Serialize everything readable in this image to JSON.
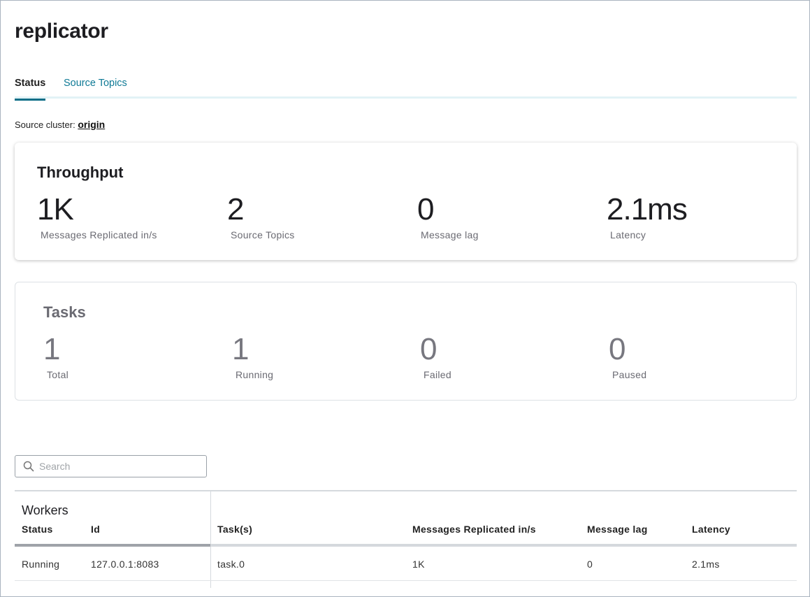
{
  "page": {
    "title": "replicator"
  },
  "tabs": [
    {
      "label": "Status",
      "active": true
    },
    {
      "label": "Source Topics",
      "active": false
    }
  ],
  "source_cluster": {
    "label": "Source cluster:",
    "value": "origin"
  },
  "throughput": {
    "title": "Throughput",
    "stats": [
      {
        "value": "1K",
        "label": "Messages Replicated in/s"
      },
      {
        "value": "2",
        "label": "Source Topics"
      },
      {
        "value": "0",
        "label": "Message lag"
      },
      {
        "value": "2.1ms",
        "label": "Latency"
      }
    ]
  },
  "tasks": {
    "title": "Tasks",
    "stats": [
      {
        "value": "1",
        "label": "Total"
      },
      {
        "value": "1",
        "label": "Running"
      },
      {
        "value": "0",
        "label": "Failed"
      },
      {
        "value": "0",
        "label": "Paused"
      }
    ]
  },
  "search": {
    "placeholder": "Search",
    "value": ""
  },
  "workers": {
    "title": "Workers",
    "columns": [
      "Status",
      "Id",
      "Task(s)",
      "Messages Replicated in/s",
      "Message lag",
      "Latency"
    ],
    "rows": [
      [
        "Running",
        "127.0.0.1:8083",
        "task.0",
        "1K",
        "0",
        "2.1ms"
      ]
    ]
  },
  "colors": {
    "accent": "#0d6e87",
    "link": "#0f7a96",
    "tab_rule": "#e2f2f6"
  },
  "icons": {
    "search": "search-icon"
  }
}
